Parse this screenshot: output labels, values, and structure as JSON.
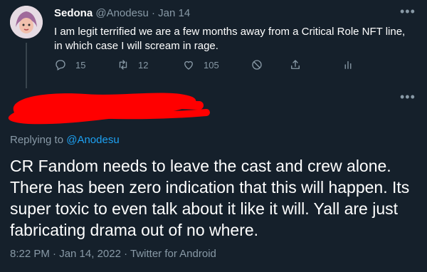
{
  "first_tweet": {
    "name": "Sedona",
    "handle": "@Anodesu",
    "separator": "·",
    "date": "Jan 14",
    "more_label": "•••",
    "text": "I am legit terrified we are a few months away from a Critical Role NFT line, in which case I will scream in rage.",
    "actions": {
      "replies": "15",
      "retweets": "12",
      "likes": "105"
    }
  },
  "second_tweet": {
    "more_label": "•••",
    "replying_prefix": "Replying to",
    "replying_handle": "@Anodesu",
    "text": "CR Fandom needs to leave the cast and crew alone. There has been zero indication that this will happen. Its super toxic to even talk about it like it will. Yall are just fabricating drama out of no where.",
    "meta": "8:22 PM · Jan 14, 2022 · Twitter for Android"
  },
  "colors": {
    "background": "#15202b",
    "text": "#ffffff",
    "muted": "#8899a6",
    "link": "#1da1f2",
    "redaction": "#ff0000"
  }
}
